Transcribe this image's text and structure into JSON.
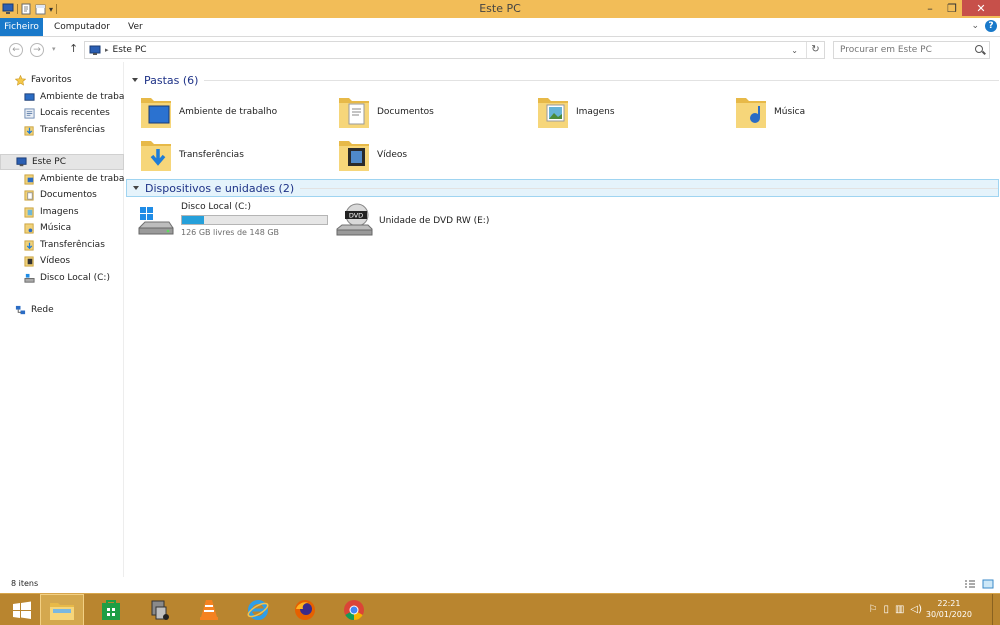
{
  "window": {
    "title": "Este PC"
  },
  "ribbon": {
    "tabs": [
      {
        "label": "Ficheiro"
      },
      {
        "label": "Computador"
      },
      {
        "label": "Ver"
      }
    ]
  },
  "address": {
    "location": "Este PC",
    "search_placeholder": "Procurar em Este PC"
  },
  "nav": {
    "favorites_label": "Favoritos",
    "favorites": [
      {
        "label": "Ambiente de trabalho"
      },
      {
        "label": "Locais recentes"
      },
      {
        "label": "Transferências"
      }
    ],
    "thispc_label": "Este PC",
    "thispc": [
      {
        "label": "Ambiente de trabalho"
      },
      {
        "label": "Documentos"
      },
      {
        "label": "Imagens"
      },
      {
        "label": "Música"
      },
      {
        "label": "Transferências"
      },
      {
        "label": "Vídeos"
      },
      {
        "label": "Disco Local (C:)"
      }
    ],
    "network_label": "Rede"
  },
  "content": {
    "folders_header": "Pastas (6)",
    "folders": [
      {
        "name": "Ambiente de trabalho",
        "icon": "desktop-folder-icon"
      },
      {
        "name": "Documentos",
        "icon": "documents-folder-icon"
      },
      {
        "name": "Imagens",
        "icon": "pictures-folder-icon"
      },
      {
        "name": "Música",
        "icon": "music-folder-icon"
      },
      {
        "name": "Transferências",
        "icon": "downloads-folder-icon"
      },
      {
        "name": "Vídeos",
        "icon": "videos-folder-icon"
      }
    ],
    "devices_header": "Dispositivos e unidades (2)",
    "drives": [
      {
        "name": "Disco Local (C:)",
        "free_text": "126 GB livres de 148 GB",
        "used_fraction": 0.149
      },
      {
        "name": "Unidade de DVD RW (E:)",
        "dvd_label": "DVD"
      }
    ]
  },
  "status": {
    "item_count": "8 itens"
  },
  "taskbar": {
    "apps": [
      "start-icon",
      "file-explorer-icon",
      "store-icon",
      "installer-icon",
      "vlc-icon",
      "internet-explorer-icon",
      "firefox-icon",
      "chrome-icon"
    ],
    "clock_time": "22:21",
    "clock_date": "30/01/2020"
  },
  "colors": {
    "titlebar": "#f2bd58",
    "taskbar": "#b9852f",
    "accent": "#1979ca",
    "progress": "#26a0da"
  }
}
